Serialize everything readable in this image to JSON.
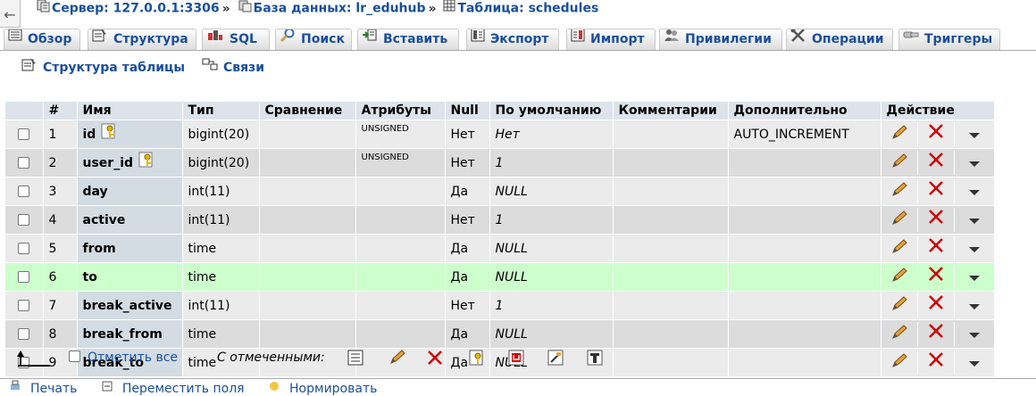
{
  "breadcrumb": {
    "server": "Сервер: 127.0.0.1:3306",
    "database": "База данных: lr_eduhub",
    "table": "Таблица: schedules",
    "separator": "»"
  },
  "tabs": [
    {
      "label": "Обзор",
      "icon": "browse-icon"
    },
    {
      "label": "Структура",
      "icon": "structure-icon"
    },
    {
      "label": "SQL",
      "icon": "sql-icon"
    },
    {
      "label": "Поиск",
      "icon": "search-icon"
    },
    {
      "label": "Вставить",
      "icon": "insert-icon"
    },
    {
      "label": "Экспорт",
      "icon": "export-icon"
    },
    {
      "label": "Импорт",
      "icon": "import-icon"
    },
    {
      "label": "Привилегии",
      "icon": "privileges-icon"
    },
    {
      "label": "Операции",
      "icon": "operations-icon"
    },
    {
      "label": "Триггеры",
      "icon": "triggers-icon"
    }
  ],
  "subnav": {
    "structure": "Структура таблицы",
    "relations": "Связи"
  },
  "table": {
    "headers": [
      "#",
      "Имя",
      "Тип",
      "Сравнение",
      "Атрибуты",
      "Null",
      "По умолчанию",
      "Комментарии",
      "Дополнительно",
      "Действие"
    ],
    "rows": [
      {
        "num": "1",
        "name": "id",
        "key": true,
        "type": "bigint(20)",
        "collation": "",
        "attributes": "UNSIGNED",
        "null": "Нет",
        "default": "Нет",
        "comments": "",
        "extra": "AUTO_INCREMENT"
      },
      {
        "num": "2",
        "name": "user_id",
        "key": true,
        "type": "bigint(20)",
        "collation": "",
        "attributes": "UNSIGNED",
        "null": "Нет",
        "default": "1",
        "comments": "",
        "extra": ""
      },
      {
        "num": "3",
        "name": "day",
        "key": false,
        "type": "int(11)",
        "collation": "",
        "attributes": "",
        "null": "Да",
        "default": "NULL",
        "comments": "",
        "extra": ""
      },
      {
        "num": "4",
        "name": "active",
        "key": false,
        "type": "int(11)",
        "collation": "",
        "attributes": "",
        "null": "Нет",
        "default": "1",
        "comments": "",
        "extra": ""
      },
      {
        "num": "5",
        "name": "from",
        "key": false,
        "type": "time",
        "collation": "",
        "attributes": "",
        "null": "Да",
        "default": "NULL",
        "comments": "",
        "extra": ""
      },
      {
        "num": "6",
        "name": "to",
        "key": false,
        "type": "time",
        "collation": "",
        "attributes": "",
        "null": "Да",
        "default": "NULL",
        "comments": "",
        "extra": "",
        "highlight": true
      },
      {
        "num": "7",
        "name": "break_active",
        "key": false,
        "type": "int(11)",
        "collation": "",
        "attributes": "",
        "null": "Нет",
        "default": "1",
        "comments": "",
        "extra": ""
      },
      {
        "num": "8",
        "name": "break_from",
        "key": false,
        "type": "time",
        "collation": "",
        "attributes": "",
        "null": "Да",
        "default": "NULL",
        "comments": "",
        "extra": ""
      },
      {
        "num": "9",
        "name": "break_to",
        "key": false,
        "type": "time",
        "collation": "",
        "attributes": "",
        "null": "Да",
        "default": "NULL",
        "comments": "",
        "extra": ""
      }
    ]
  },
  "bottom": {
    "check_all": "Отметить все",
    "with_selected": "С отмеченными:"
  },
  "footer": {
    "print": "Печать",
    "move": "Переместить поля",
    "normalize": "Нормировать"
  },
  "colors": {
    "link": "#1a4f9c",
    "header_bg": "#dce3ea",
    "row_odd": "#ebebeb",
    "row_even": "#dcdcdc",
    "row_highlight": "#ccffcc",
    "delete_red": "#cc0000"
  }
}
